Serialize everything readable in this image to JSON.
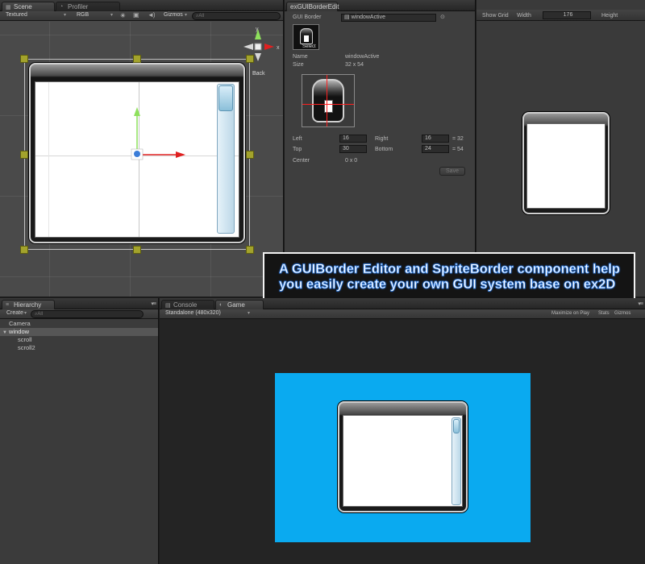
{
  "scene": {
    "tabs": [
      {
        "label": "Scene"
      },
      {
        "label": "Profiler"
      }
    ],
    "toolbar": {
      "render_mode": "Textured",
      "channel": "RGB",
      "gizmos": "Gizmos",
      "search_placeholder": "All"
    },
    "gizmo": {
      "y_axis": "y",
      "x_axis": "x",
      "view_label": "Back"
    }
  },
  "editor": {
    "tab_label": "exGUIBorderEdit",
    "gui_border_label": "GUI Border",
    "asset_name": "windowActive",
    "select_label": "Select",
    "name_label": "Name",
    "name_value": "windowActive",
    "size_label": "Size",
    "size_value": "32 x 54",
    "left_label": "Left",
    "left_value": "16",
    "right_label": "Right",
    "right_value": "16",
    "horizontal_total": "= 32",
    "top_label": "Top",
    "top_value": "30",
    "bottom_label": "Bottom",
    "bottom_value": "24",
    "vertical_total": "= 54",
    "center_label": "Center",
    "center_value": "0 x 0",
    "save_label": "Save"
  },
  "preview": {
    "show_grid_label": "Show Grid",
    "width_label": "Width",
    "width_value": "176",
    "height_label": "Height"
  },
  "caption": {
    "text": "A GUIBorder Editor and SpriteBorder component help you easily create your own GUI system base on ex2D"
  },
  "hierarchy": {
    "tab_label": "Hierarchy",
    "create_label": "Create",
    "search_placeholder": "All",
    "items": [
      {
        "label": "Camera",
        "indent": 1,
        "selected": false
      },
      {
        "label": "window",
        "indent": 0,
        "selected": true
      },
      {
        "label": "scroll",
        "indent": 2,
        "selected": false
      },
      {
        "label": "scroll2",
        "indent": 2,
        "selected": false
      }
    ]
  },
  "game": {
    "tabs": [
      {
        "label": "Console"
      },
      {
        "label": "Game"
      }
    ],
    "resolution": "Standalone (480x320)",
    "maximize_label": "Maximize on Play",
    "stats_label": "Stats",
    "gizmos_label": "Gizmos",
    "background_color": "#0aaaf0"
  },
  "colors": {
    "handle": "#a3a32c",
    "y_arrow": "#8ee05c",
    "x_arrow": "#e02020",
    "guide": "#ff2020"
  }
}
